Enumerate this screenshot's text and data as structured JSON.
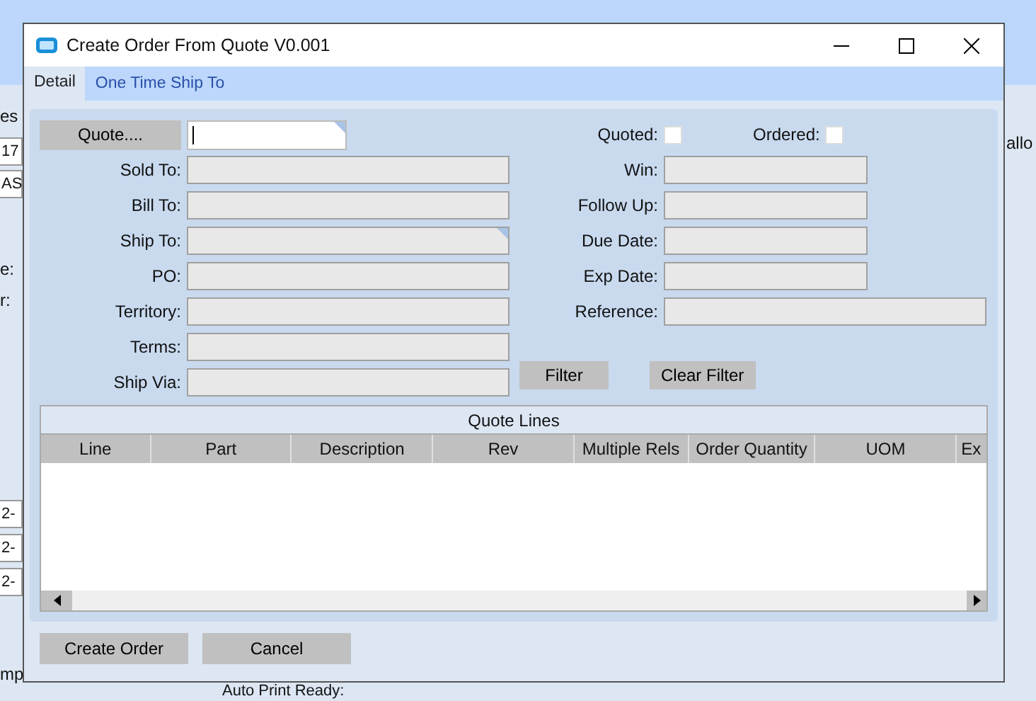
{
  "background_app": {
    "fragments": [
      {
        "kind": "label",
        "text": "es"
      },
      {
        "kind": "label",
        "text": "allo"
      },
      {
        "kind": "field",
        "text": "17"
      },
      {
        "kind": "field",
        "text": "AS"
      },
      {
        "kind": "label",
        "text": "e:"
      },
      {
        "kind": "label",
        "text": "r:"
      },
      {
        "kind": "field",
        "text": "2-"
      },
      {
        "kind": "field",
        "text": "2-"
      },
      {
        "kind": "field",
        "text": "2-"
      },
      {
        "kind": "label",
        "text": "mp"
      },
      {
        "kind": "label",
        "text": "Auto Print Ready:"
      }
    ]
  },
  "window": {
    "title": "Create Order From Quote V0.001"
  },
  "tabs": [
    {
      "label": "Detail",
      "selected": true
    },
    {
      "label": "One Time Ship To",
      "selected": false
    }
  ],
  "quote": {
    "button": "Quote...."
  },
  "left_fields": [
    {
      "label": "Sold To:",
      "kind": "text"
    },
    {
      "label": "Bill To:",
      "kind": "text"
    },
    {
      "label": "Ship To:",
      "kind": "lookup"
    },
    {
      "label": "PO:",
      "kind": "text"
    },
    {
      "label": "Territory:",
      "kind": "text"
    },
    {
      "label": "Terms:",
      "kind": "text"
    },
    {
      "label": "Ship Via:",
      "kind": "text"
    }
  ],
  "checks": [
    {
      "label": "Quoted:",
      "checked": false
    },
    {
      "label": "Ordered:",
      "checked": false
    }
  ],
  "right_fields": [
    {
      "label": "Win:",
      "kind": "short"
    },
    {
      "label": "Follow Up:",
      "kind": "short"
    },
    {
      "label": "Due Date:",
      "kind": "short"
    },
    {
      "label": "Exp Date:",
      "kind": "short"
    },
    {
      "label": "Reference:",
      "kind": "wide"
    }
  ],
  "filter_buttons": [
    "Filter",
    "Clear Filter"
  ],
  "table": {
    "title": "Quote Lines",
    "columns": [
      "Line",
      "Part",
      "Description",
      "Rev",
      "Multiple Rels",
      "Order Quantity",
      "UOM",
      "Ex"
    ]
  },
  "buttons": [
    "Create Order",
    "Cancel"
  ]
}
